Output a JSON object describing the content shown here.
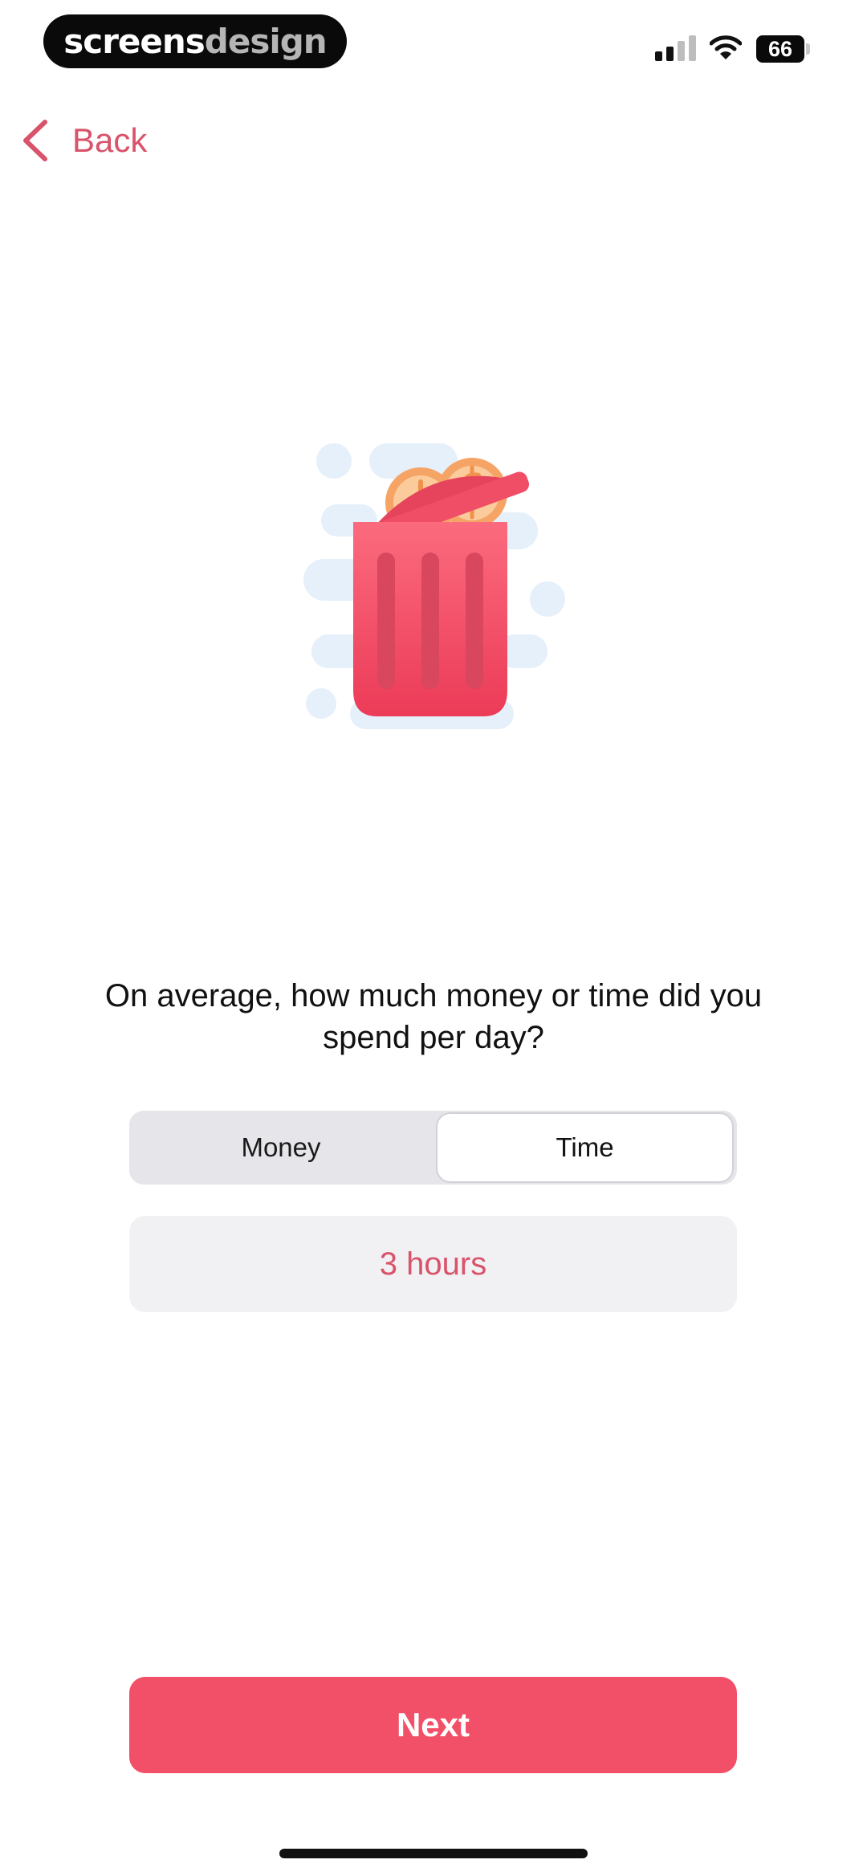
{
  "status_bar": {
    "brand_left": "screens",
    "brand_right": "design",
    "battery_level": "66",
    "icons": [
      "signal-icon",
      "wifi-icon",
      "battery-icon"
    ]
  },
  "nav": {
    "back_label": "Back",
    "back_icon": "chevron-left-icon"
  },
  "illustration": {
    "icon": "trash-can-with-coins-icon"
  },
  "question": {
    "text": "On average, how much money or time did you spend per day?"
  },
  "segmented_control": {
    "options": [
      "Money",
      "Time"
    ],
    "selected": "Time"
  },
  "value_field": {
    "value": "3 hours"
  },
  "next_button": {
    "label": "Next"
  },
  "colors": {
    "accent": "#f25068",
    "accent_text": "#d9536a",
    "field_background": "#f1f1f4",
    "segment_background": "#e6e6ea"
  }
}
